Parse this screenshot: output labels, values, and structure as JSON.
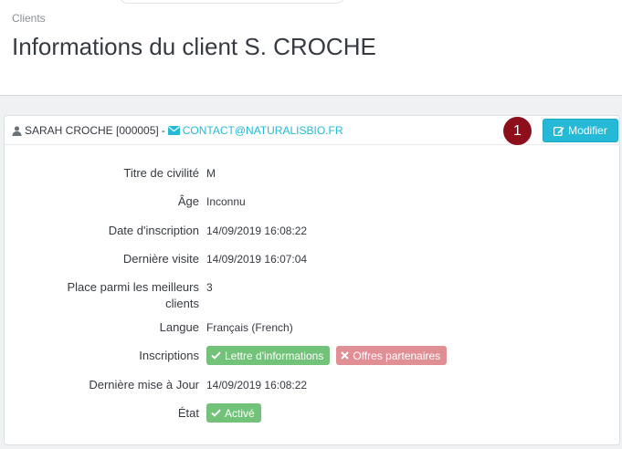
{
  "breadcrumb": "Clients",
  "title": "Informations du client S. CROCHE",
  "panel": {
    "customer_name": "SARAH CROCHE [000005]",
    "separator": "-",
    "email": "CONTACT@NATURALISBIO.FR",
    "step_number": "1",
    "edit_label": "Modifier"
  },
  "details": [
    {
      "label": "Titre de civilité",
      "value": "M"
    },
    {
      "label": "Âge",
      "value": "Inconnu"
    },
    {
      "label": "Date d'inscription",
      "value": "14/09/2019 16:08:22"
    },
    {
      "label": "Dernière visite",
      "value": "14/09/2019 16:07:04"
    },
    {
      "label": "Place parmi les meilleurs clients",
      "value": "3"
    },
    {
      "label": "Langue",
      "value": "Français (French)"
    },
    {
      "label": "Inscriptions",
      "badges": [
        {
          "label": "Lettre d'informations",
          "status": "yes",
          "icon": "check-icon"
        },
        {
          "label": "Offres partenaires",
          "status": "no",
          "icon": "x-icon"
        }
      ]
    },
    {
      "label": "Dernière mise à Jour",
      "value": "14/09/2019 16:08:22"
    },
    {
      "label": "État",
      "badges": [
        {
          "label": "Activé",
          "status": "yes",
          "icon": "check-icon"
        }
      ]
    }
  ],
  "colors": {
    "accent": "#25b9d7",
    "success": "#72c279",
    "danger": "#e08f95",
    "step": "#8c0f1b"
  }
}
